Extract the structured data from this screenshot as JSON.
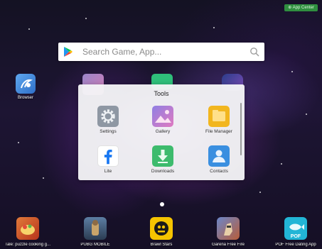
{
  "status_badge": "⊕ App Center",
  "search": {
    "placeholder": "Search Game, App..."
  },
  "desktop": {
    "browser_label": "Browser"
  },
  "folder": {
    "title": "Tools",
    "items": [
      {
        "label": "Settings",
        "icon": "gear-icon"
      },
      {
        "label": "Gallery",
        "icon": "gallery-icon"
      },
      {
        "label": "File Manager",
        "icon": "folder-icon"
      },
      {
        "label": "Lite",
        "icon": "facebook-icon"
      },
      {
        "label": "Downloads",
        "icon": "download-icon"
      },
      {
        "label": "Contacts",
        "icon": "contacts-icon"
      }
    ]
  },
  "dock": [
    {
      "label": "Tale: puzzle cooking g...",
      "icon": "tale-game-icon"
    },
    {
      "label": "PUBG MOBILE",
      "icon": "pubg-icon"
    },
    {
      "label": "Brawl Stars",
      "icon": "brawl-stars-icon"
    },
    {
      "label": "Garena Free Fire",
      "icon": "free-fire-icon"
    },
    {
      "label": "POF Free Dating App",
      "icon": "pof-icon"
    }
  ],
  "page_indicator": {
    "current": 1
  },
  "colors": {
    "accent_green": "#2f8f3f",
    "folder_bg": "#f4f4f6"
  }
}
